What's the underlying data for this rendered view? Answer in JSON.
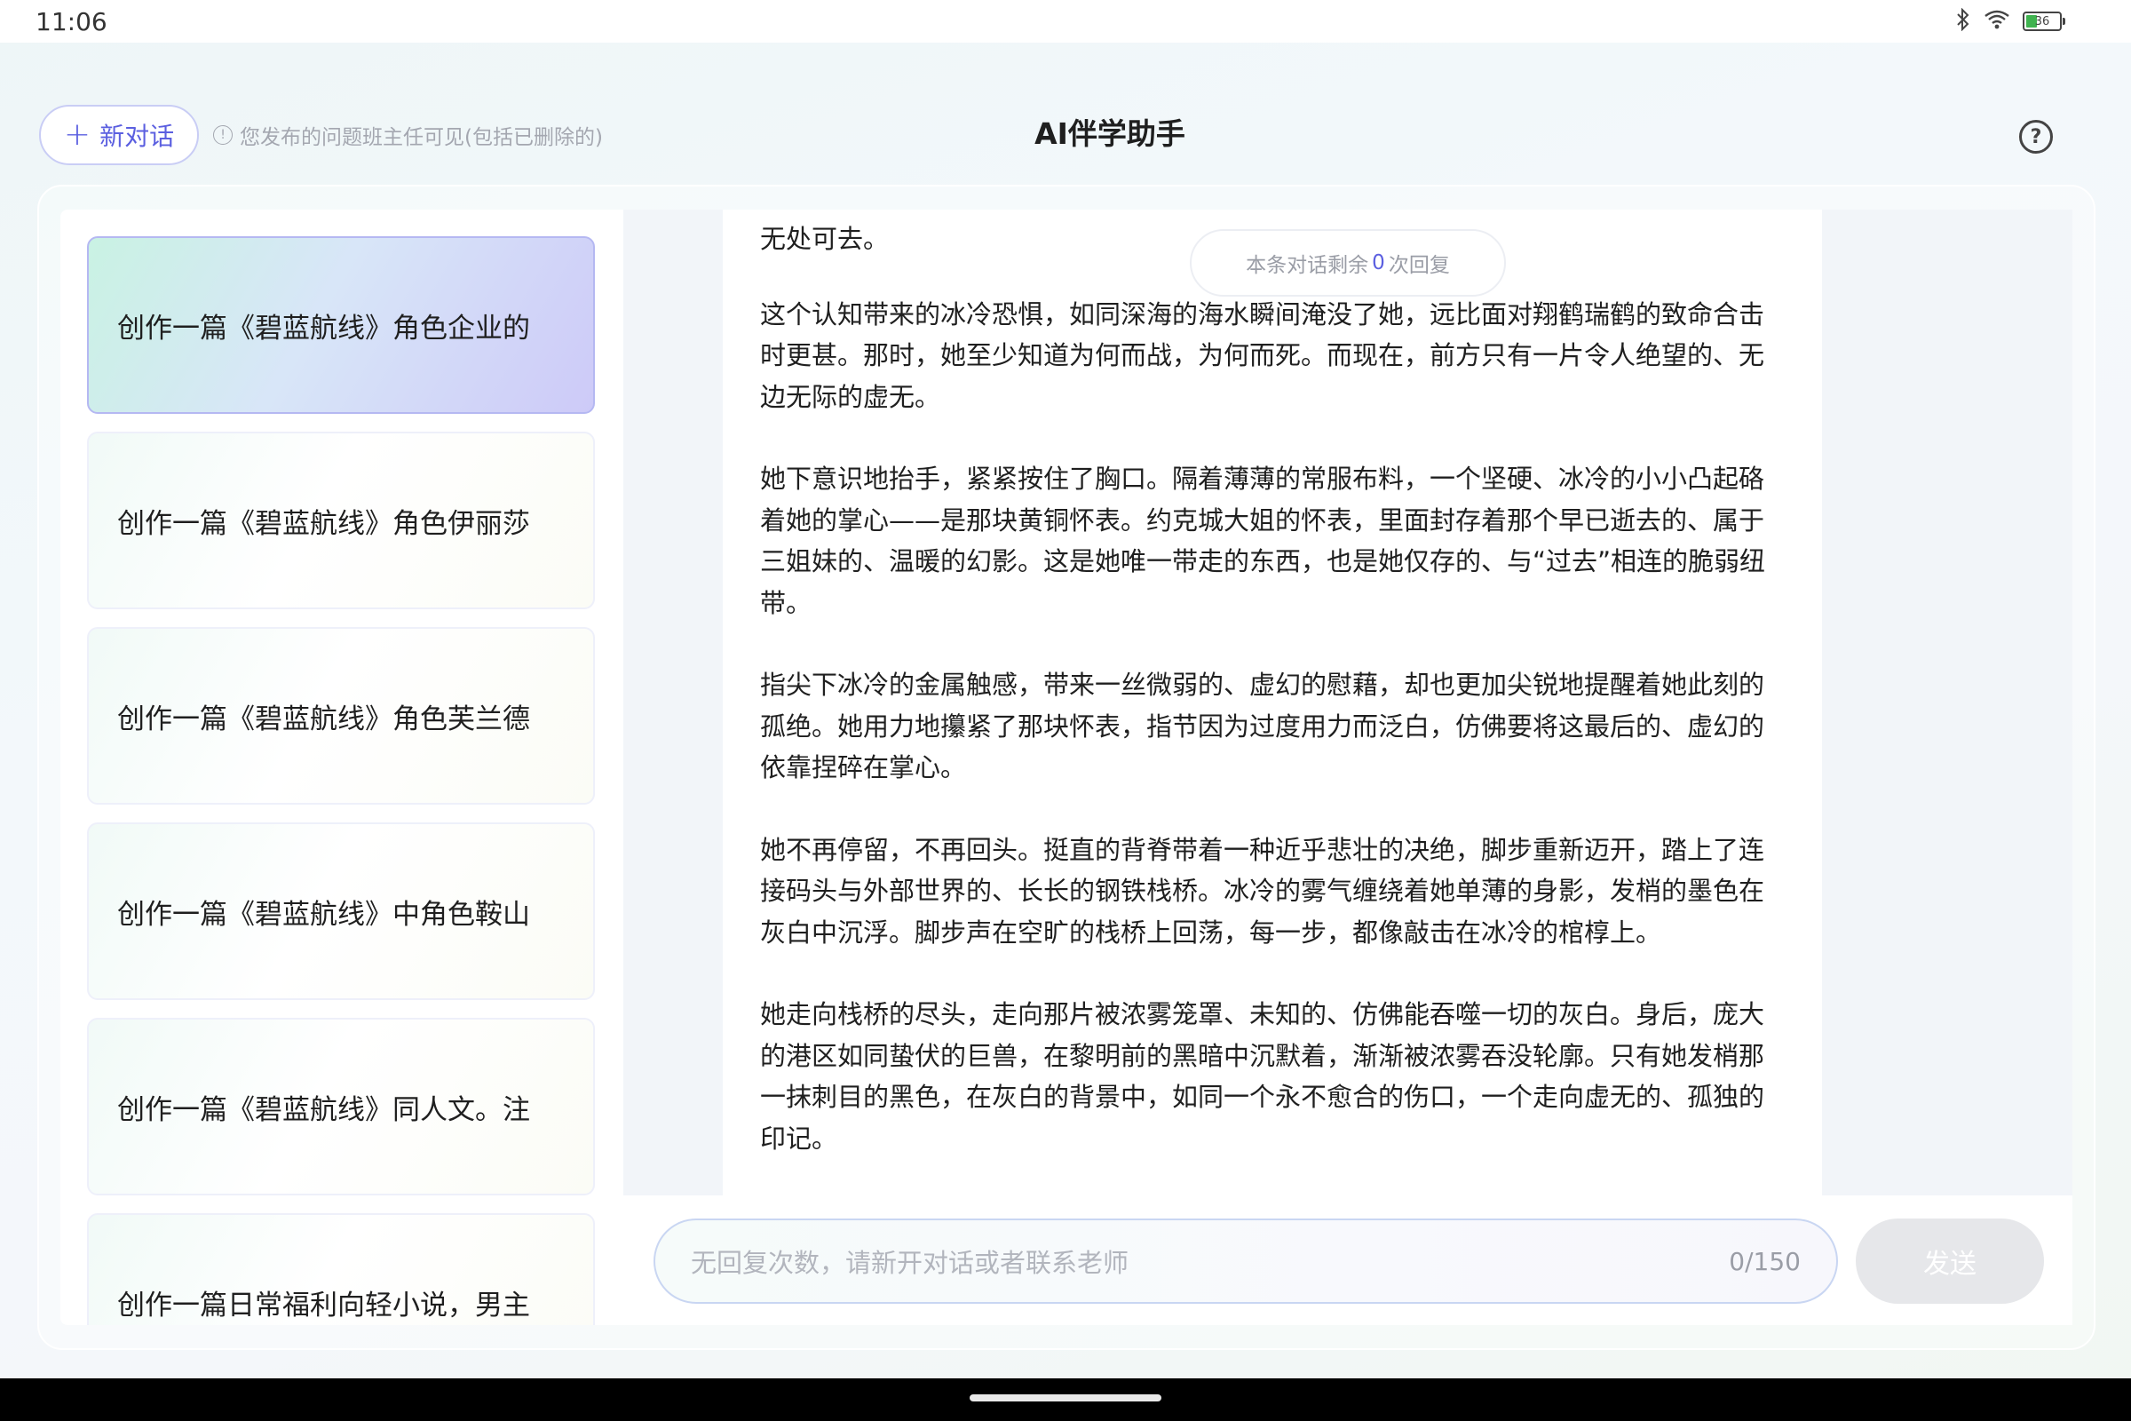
{
  "status_bar": {
    "time": "11:06",
    "battery": "36",
    "icons": [
      "bluetooth-icon",
      "wifi-icon",
      "battery-icon"
    ]
  },
  "header": {
    "new_chat_label": "新对话",
    "notice": "您发布的问题班主任可见(包括已删除的)",
    "title": "AI伴学助手",
    "help_icon": "?"
  },
  "sidebar": {
    "items": [
      {
        "label": "创作一篇《碧蓝航线》角色企业的",
        "active": true
      },
      {
        "label": "创作一篇《碧蓝航线》角色伊丽莎",
        "active": false
      },
      {
        "label": "创作一篇《碧蓝航线》角色芙兰德",
        "active": false
      },
      {
        "label": "创作一篇《碧蓝航线》中角色鞍山",
        "active": false
      },
      {
        "label": "创作一篇《碧蓝航线》同人文。注",
        "active": false
      },
      {
        "label": "创作一篇日常福利向轻小说，男主",
        "active": false
      }
    ]
  },
  "chat": {
    "remaining": {
      "prefix": "本条对话剩余",
      "count": "0",
      "suffix": "次回复"
    },
    "paragraphs": [
      "无处可去。",
      "这个认知带来的冰冷恐惧，如同深海的海水瞬间淹没了她，远比面对翔鹤瑞鹤的致命合击时更甚。那时，她至少知道为何而战，为何而死。而现在，前方只有一片令人绝望的、无边无际的虚无。",
      "她下意识地抬手，紧紧按住了胸口。隔着薄薄的常服布料，一个坚硬、冰冷的小小凸起硌着她的掌心——是那块黄铜怀表。约克城大姐的怀表，里面封存着那个早已逝去的、属于三姐妹的、温暖的幻影。这是她唯一带走的东西，也是她仅存的、与“过去”相连的脆弱纽带。",
      "指尖下冰冷的金属触感，带来一丝微弱的、虚幻的慰藉，却也更加尖锐地提醒着她此刻的孤绝。她用力地攥紧了那块怀表，指节因为过度用力而泛白，仿佛要将这最后的、虚幻的依靠捏碎在掌心。",
      "她不再停留，不再回头。挺直的背脊带着一种近乎悲壮的决绝，脚步重新迈开，踏上了连接码头与外部世界的、长长的钢铁栈桥。冰冷的雾气缠绕着她单薄的身影，发梢的墨色在灰白中沉浮。脚步声在空旷的栈桥上回荡，每一步，都像敲击在冰冷的棺椁上。",
      "她走向栈桥的尽头，走向那片被浓雾笼罩、未知的、仿佛能吞噬一切的灰白。身后，庞大的港区如同蛰伏的巨兽，在黎明前的黑暗中沉默着，渐渐被浓雾吞没轮廓。只有她发梢那一抹刺目的黑色，在灰白的背景中，如同一个永不愈合的伤口，一个走向虚无的、孤独的印记。"
    ]
  },
  "input": {
    "placeholder": "无回复次数，请新开对话或者联系老师",
    "counter": "0/150",
    "send_label": "发送"
  },
  "colors": {
    "accent": "#5b5fe0",
    "active_item_gradient": [
      "#c9f2e3",
      "#cdcaf8"
    ],
    "send_disabled": "#e6e7ea"
  }
}
